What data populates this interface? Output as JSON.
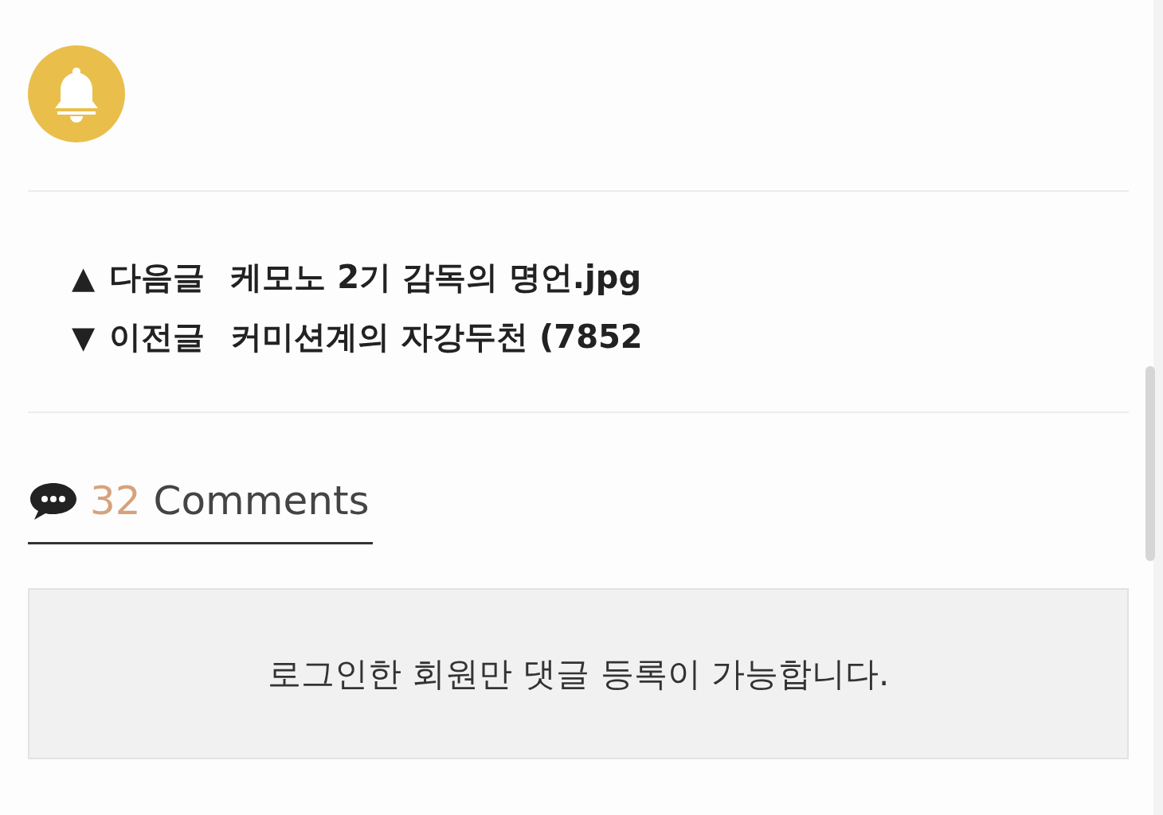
{
  "post_nav": [
    {
      "arrow": "▲",
      "label": "다음글",
      "title": "케모노 2기 감독의 명언.jpg"
    },
    {
      "arrow": "▼",
      "label": "이전글",
      "title": "커미션계의 자강두천 (7852"
    }
  ],
  "comments": {
    "count": "32",
    "label": "Comments"
  },
  "login_notice": "로그인한 회원만 댓글 등록이 가능합니다."
}
